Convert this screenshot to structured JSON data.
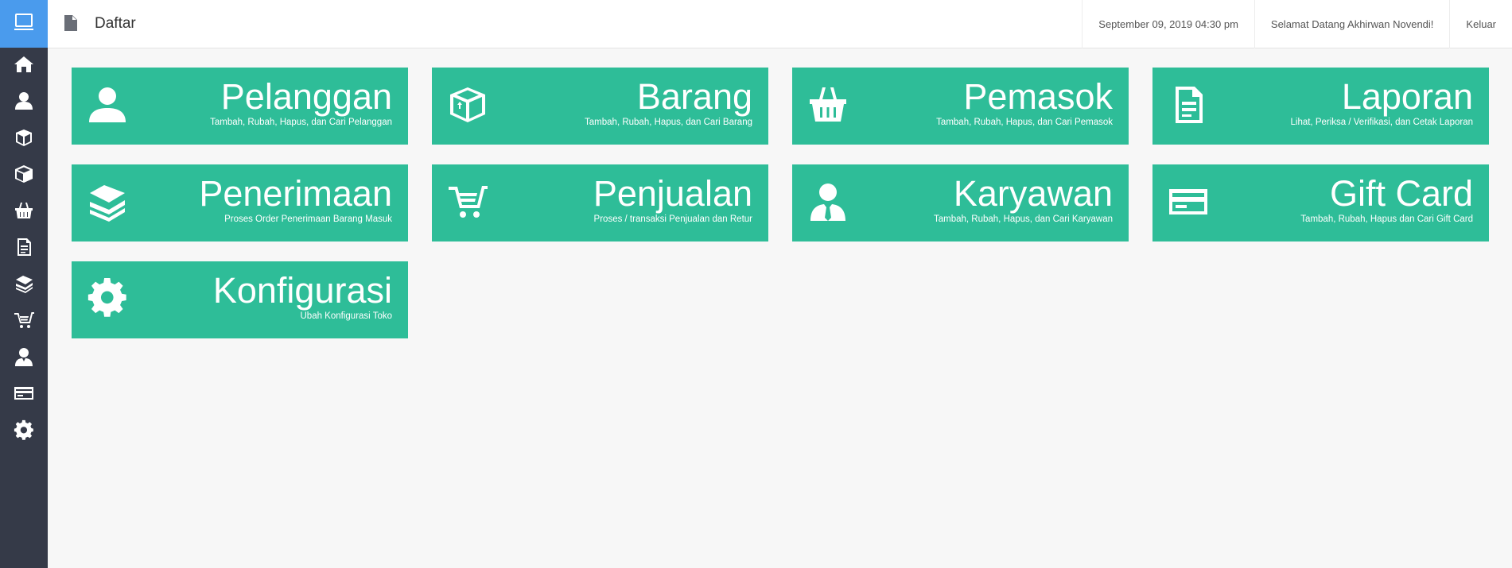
{
  "header": {
    "page_title": "Daftar",
    "datetime": "September 09, 2019 04:30 pm",
    "welcome": "Selamat Datang Akhirwan Novendi!",
    "logout_label": "Keluar"
  },
  "sidebar": {
    "items": [
      {
        "icon": "home-icon"
      },
      {
        "icon": "user-icon"
      },
      {
        "icon": "box-icon"
      },
      {
        "icon": "cube-icon"
      },
      {
        "icon": "basket-icon"
      },
      {
        "icon": "document-icon"
      },
      {
        "icon": "books-icon"
      },
      {
        "icon": "cart-icon"
      },
      {
        "icon": "employee-icon"
      },
      {
        "icon": "credit-card-icon"
      },
      {
        "icon": "gear-icon"
      }
    ]
  },
  "tiles": [
    {
      "title": "Pelanggan",
      "subtitle": "Tambah, Rubah, Hapus, dan Cari Pelanggan",
      "icon": "user-icon"
    },
    {
      "title": "Barang",
      "subtitle": "Tambah, Rubah, Hapus, dan Cari Barang",
      "icon": "box-icon"
    },
    {
      "title": "Pemasok",
      "subtitle": "Tambah, Rubah, Hapus, dan Cari Pemasok",
      "icon": "basket-icon"
    },
    {
      "title": "Laporan",
      "subtitle": "Lihat, Periksa / Verifikasi, dan Cetak Laporan",
      "icon": "document-icon"
    },
    {
      "title": "Penerimaan",
      "subtitle": "Proses Order Penerimaan Barang Masuk",
      "icon": "books-icon"
    },
    {
      "title": "Penjualan",
      "subtitle": "Proses / transaksi Penjualan dan Retur",
      "icon": "cart-icon"
    },
    {
      "title": "Karyawan",
      "subtitle": "Tambah, Rubah, Hapus, dan Cari Karyawan",
      "icon": "employee-icon"
    },
    {
      "title": "Gift Card",
      "subtitle": "Tambah, Rubah, Hapus dan Cari Gift Card",
      "icon": "credit-card-icon"
    },
    {
      "title": "Konfigurasi",
      "subtitle": "Ubah Konfigurasi Toko",
      "icon": "gear-icon"
    }
  ],
  "colors": {
    "sidebar_bg": "#353a48",
    "logo_bg": "#4a9bed",
    "tile_bg": "#2ebd98",
    "page_bg": "#f7f7f7"
  }
}
